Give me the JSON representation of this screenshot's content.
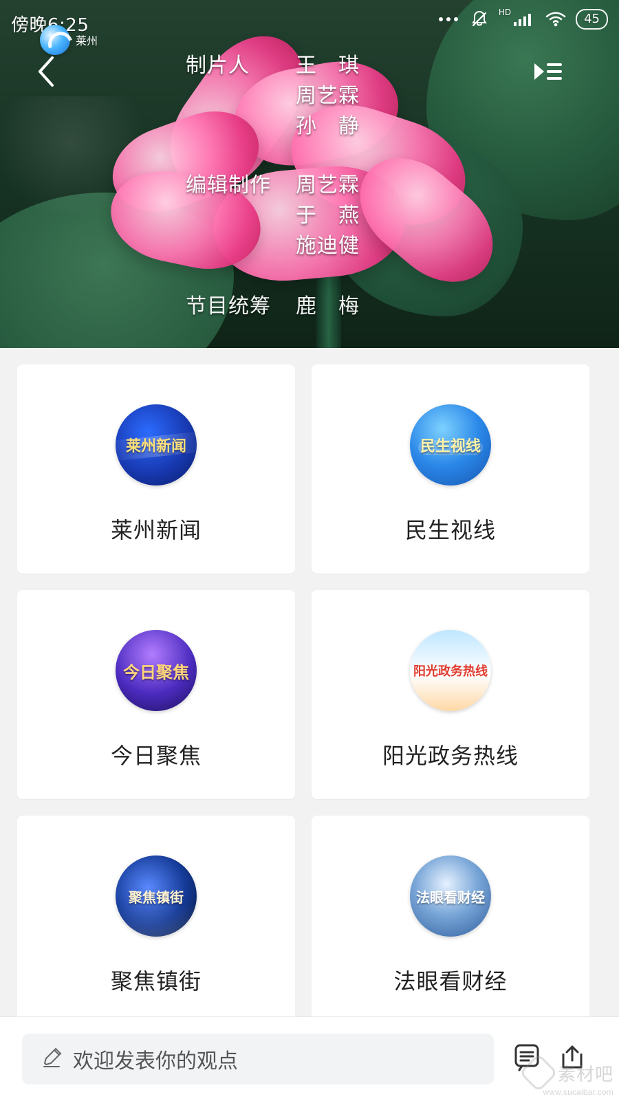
{
  "status_bar": {
    "time": "傍晚6:25",
    "network_badge": "HD",
    "battery_level": "45"
  },
  "video": {
    "channel_logo_text": "莱州",
    "credits": [
      {
        "role": "制片人",
        "names": [
          "王　琪",
          "周艺霖",
          "孙　静"
        ]
      },
      {
        "role": "编辑制作",
        "names": [
          "周艺霖",
          "于　燕",
          "施迪健"
        ]
      },
      {
        "role": "节目统筹",
        "names": [
          "鹿　梅"
        ]
      }
    ]
  },
  "programs": [
    {
      "title": "莱州新闻",
      "thumb_text": "莱州新闻",
      "thumb_style": "t1"
    },
    {
      "title": "民生视线",
      "thumb_text": "民生视线",
      "thumb_style": "t2"
    },
    {
      "title": "今日聚焦",
      "thumb_text": "今日聚焦",
      "thumb_style": "t3"
    },
    {
      "title": "阳光政务热线",
      "thumb_text": "阳光政务热线",
      "thumb_style": "t4"
    },
    {
      "title": "聚焦镇街",
      "thumb_text": "聚焦镇街",
      "thumb_style": "t5"
    },
    {
      "title": "法眼看财经",
      "thumb_text": "法眼看财经",
      "thumb_style": "t6"
    }
  ],
  "comment": {
    "placeholder": "欢迎发表你的观点"
  },
  "watermark": {
    "text": "素材吧",
    "url": "www.sucaibar.com"
  }
}
